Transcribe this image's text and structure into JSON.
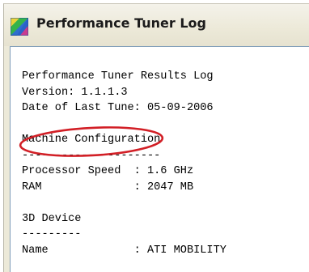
{
  "window": {
    "title": "Performance Tuner Log",
    "icon": "performance-tuner-app-icon"
  },
  "log": {
    "lines": [
      "Performance Tuner Results Log",
      "Version: 1.1.1.3",
      "Date of Last Tune: 05-09-2006",
      "",
      "Machine Configuration",
      "---------------------",
      "Processor Speed  : 1.6 GHz",
      "RAM              : 2047 MB",
      "",
      "3D Device",
      "---------",
      "Name             : ATI MOBILITY"
    ]
  },
  "colors": {
    "annotation_circle": "#d21f26",
    "client_border": "#7f9db9",
    "window_chrome": "#ece9d8"
  }
}
